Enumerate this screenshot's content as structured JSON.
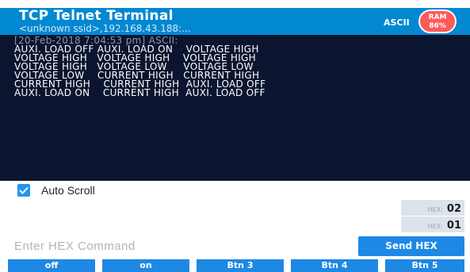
{
  "app": {
    "title": "TCP Telnet Terminal",
    "subtitle": "<unknown ssid>,192.168.43.188:...",
    "mode": "ASCII",
    "ram_label": "RAM",
    "ram_value": "86%",
    "header_color": "#0288d1",
    "ram_badge_color": "#ff5a5a"
  },
  "terminal": {
    "header": "[20-Feb-2018 7:04:53 pm] ASCII:",
    "lines": [
      "AUXI. LOAD OFF AUXI. LOAD ON    VOLTAGE HIGH",
      "VOLTAGE HIGH   VOLTAGE HIGH    VOLTAGE HIGH",
      "VOLTAGE HIGH   VOLTAGE LOW     VOLTAGE LOW",
      "VOLTAGE LOW    CURRENT HIGH   CURRENT HIGH",
      "CURRENT HIGH    CURRENT HIGH  AUXI. LOAD OFF",
      "AUXI. LOAD ON    CURRENT HIGH  AUXI. LOAD OFF"
    ],
    "background_color": "#0b1530"
  },
  "autoscroll": {
    "label": "Auto Scroll",
    "checked": true
  },
  "hex_buttons": [
    {
      "prefix": "HEX:",
      "value": "02"
    },
    {
      "prefix": "HEX:",
      "value": "01"
    }
  ],
  "command": {
    "placeholder": "Enter HEX Command",
    "value": "",
    "send_label": "Send HEX"
  },
  "macro_buttons": [
    {
      "label": "off"
    },
    {
      "label": "on"
    },
    {
      "label": "Btn 3"
    },
    {
      "label": "Btn 4"
    },
    {
      "label": "Btn 5"
    }
  ],
  "accent_color": "#1e88e5"
}
